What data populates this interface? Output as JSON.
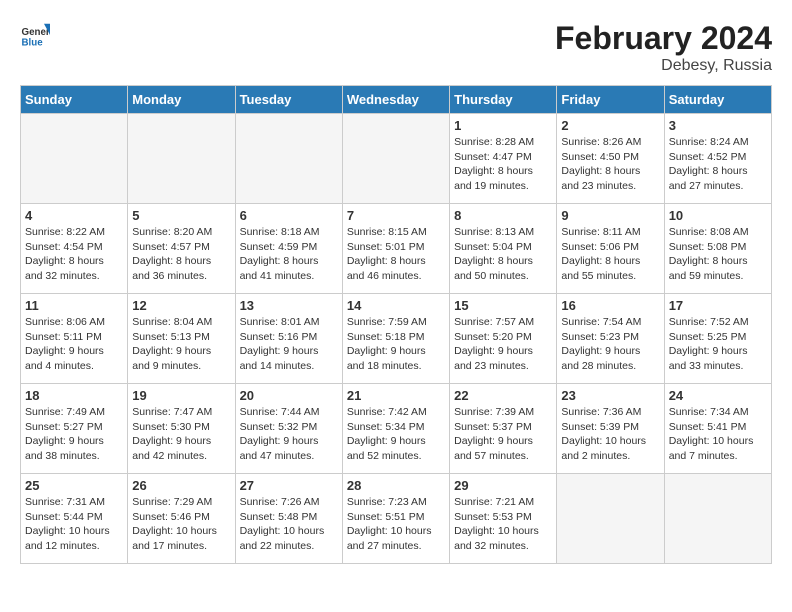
{
  "header": {
    "logo_line1": "General",
    "logo_line2": "Blue",
    "month_title": "February 2024",
    "location": "Debesy, Russia"
  },
  "weekdays": [
    "Sunday",
    "Monday",
    "Tuesday",
    "Wednesday",
    "Thursday",
    "Friday",
    "Saturday"
  ],
  "weeks": [
    [
      {
        "day": "",
        "info": ""
      },
      {
        "day": "",
        "info": ""
      },
      {
        "day": "",
        "info": ""
      },
      {
        "day": "",
        "info": ""
      },
      {
        "day": "1",
        "info": "Sunrise: 8:28 AM\nSunset: 4:47 PM\nDaylight: 8 hours\nand 19 minutes."
      },
      {
        "day": "2",
        "info": "Sunrise: 8:26 AM\nSunset: 4:50 PM\nDaylight: 8 hours\nand 23 minutes."
      },
      {
        "day": "3",
        "info": "Sunrise: 8:24 AM\nSunset: 4:52 PM\nDaylight: 8 hours\nand 27 minutes."
      }
    ],
    [
      {
        "day": "4",
        "info": "Sunrise: 8:22 AM\nSunset: 4:54 PM\nDaylight: 8 hours\nand 32 minutes."
      },
      {
        "day": "5",
        "info": "Sunrise: 8:20 AM\nSunset: 4:57 PM\nDaylight: 8 hours\nand 36 minutes."
      },
      {
        "day": "6",
        "info": "Sunrise: 8:18 AM\nSunset: 4:59 PM\nDaylight: 8 hours\nand 41 minutes."
      },
      {
        "day": "7",
        "info": "Sunrise: 8:15 AM\nSunset: 5:01 PM\nDaylight: 8 hours\nand 46 minutes."
      },
      {
        "day": "8",
        "info": "Sunrise: 8:13 AM\nSunset: 5:04 PM\nDaylight: 8 hours\nand 50 minutes."
      },
      {
        "day": "9",
        "info": "Sunrise: 8:11 AM\nSunset: 5:06 PM\nDaylight: 8 hours\nand 55 minutes."
      },
      {
        "day": "10",
        "info": "Sunrise: 8:08 AM\nSunset: 5:08 PM\nDaylight: 8 hours\nand 59 minutes."
      }
    ],
    [
      {
        "day": "11",
        "info": "Sunrise: 8:06 AM\nSunset: 5:11 PM\nDaylight: 9 hours\nand 4 minutes."
      },
      {
        "day": "12",
        "info": "Sunrise: 8:04 AM\nSunset: 5:13 PM\nDaylight: 9 hours\nand 9 minutes."
      },
      {
        "day": "13",
        "info": "Sunrise: 8:01 AM\nSunset: 5:16 PM\nDaylight: 9 hours\nand 14 minutes."
      },
      {
        "day": "14",
        "info": "Sunrise: 7:59 AM\nSunset: 5:18 PM\nDaylight: 9 hours\nand 18 minutes."
      },
      {
        "day": "15",
        "info": "Sunrise: 7:57 AM\nSunset: 5:20 PM\nDaylight: 9 hours\nand 23 minutes."
      },
      {
        "day": "16",
        "info": "Sunrise: 7:54 AM\nSunset: 5:23 PM\nDaylight: 9 hours\nand 28 minutes."
      },
      {
        "day": "17",
        "info": "Sunrise: 7:52 AM\nSunset: 5:25 PM\nDaylight: 9 hours\nand 33 minutes."
      }
    ],
    [
      {
        "day": "18",
        "info": "Sunrise: 7:49 AM\nSunset: 5:27 PM\nDaylight: 9 hours\nand 38 minutes."
      },
      {
        "day": "19",
        "info": "Sunrise: 7:47 AM\nSunset: 5:30 PM\nDaylight: 9 hours\nand 42 minutes."
      },
      {
        "day": "20",
        "info": "Sunrise: 7:44 AM\nSunset: 5:32 PM\nDaylight: 9 hours\nand 47 minutes."
      },
      {
        "day": "21",
        "info": "Sunrise: 7:42 AM\nSunset: 5:34 PM\nDaylight: 9 hours\nand 52 minutes."
      },
      {
        "day": "22",
        "info": "Sunrise: 7:39 AM\nSunset: 5:37 PM\nDaylight: 9 hours\nand 57 minutes."
      },
      {
        "day": "23",
        "info": "Sunrise: 7:36 AM\nSunset: 5:39 PM\nDaylight: 10 hours\nand 2 minutes."
      },
      {
        "day": "24",
        "info": "Sunrise: 7:34 AM\nSunset: 5:41 PM\nDaylight: 10 hours\nand 7 minutes."
      }
    ],
    [
      {
        "day": "25",
        "info": "Sunrise: 7:31 AM\nSunset: 5:44 PM\nDaylight: 10 hours\nand 12 minutes."
      },
      {
        "day": "26",
        "info": "Sunrise: 7:29 AM\nSunset: 5:46 PM\nDaylight: 10 hours\nand 17 minutes."
      },
      {
        "day": "27",
        "info": "Sunrise: 7:26 AM\nSunset: 5:48 PM\nDaylight: 10 hours\nand 22 minutes."
      },
      {
        "day": "28",
        "info": "Sunrise: 7:23 AM\nSunset: 5:51 PM\nDaylight: 10 hours\nand 27 minutes."
      },
      {
        "day": "29",
        "info": "Sunrise: 7:21 AM\nSunset: 5:53 PM\nDaylight: 10 hours\nand 32 minutes."
      },
      {
        "day": "",
        "info": ""
      },
      {
        "day": "",
        "info": ""
      }
    ]
  ]
}
